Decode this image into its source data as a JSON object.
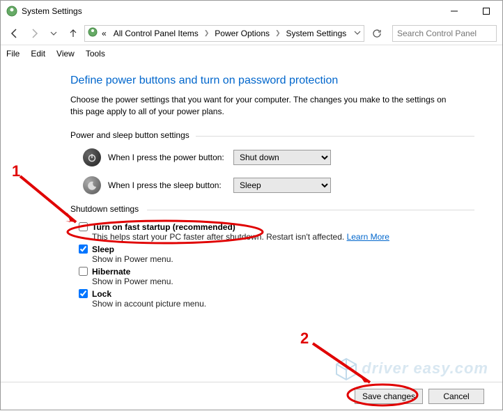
{
  "window": {
    "title": "System Settings"
  },
  "breadcrumb": {
    "prefix": "«",
    "item1": "All Control Panel Items",
    "item2": "Power Options",
    "item3": "System Settings"
  },
  "search": {
    "placeholder": "Search Control Panel"
  },
  "menu": {
    "file": "File",
    "edit": "Edit",
    "view": "View",
    "tools": "Tools"
  },
  "page": {
    "title": "Define power buttons and turn on password protection",
    "subtitle": "Choose the power settings that you want for your computer. The changes you make to the settings on this page apply to all of your power plans."
  },
  "power_group": {
    "title": "Power and sleep button settings",
    "power_label": "When I press the power button:",
    "power_value": "Shut down",
    "sleep_label": "When I press the sleep button:",
    "sleep_value": "Sleep"
  },
  "shutdown_group": {
    "title": "Shutdown settings",
    "fast": {
      "label": "Turn on fast startup (recommended)",
      "desc": "This helps start your PC faster after shutdown. Restart isn't affected. ",
      "link": "Learn More"
    },
    "sleep": {
      "label": "Sleep",
      "desc": "Show in Power menu."
    },
    "hibernate": {
      "label": "Hibernate",
      "desc": "Show in Power menu."
    },
    "lock": {
      "label": "Lock",
      "desc": "Show in account picture menu."
    }
  },
  "buttons": {
    "save": "Save changes",
    "cancel": "Cancel"
  },
  "annotations": {
    "num1": "1",
    "num2": "2"
  },
  "watermark": {
    "text": "driver easy.com"
  }
}
